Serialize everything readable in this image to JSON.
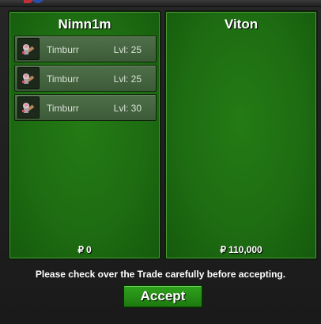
{
  "left_panel": {
    "player_name": "Nimn1m",
    "pokemon": [
      {
        "name": "Timburr",
        "level": "Lvl: 25",
        "icon": "timburr-icon"
      },
      {
        "name": "Timburr",
        "level": "Lvl: 25",
        "icon": "timburr-icon"
      },
      {
        "name": "Timburr",
        "level": "Lvl: 30",
        "icon": "timburr-icon"
      }
    ],
    "money_symbol": "₽",
    "money": "0"
  },
  "right_panel": {
    "player_name": "Viton",
    "money_symbol": "₽",
    "money": "110,000"
  },
  "notice": "Please check over the Trade carefully before accepting.",
  "accept_label": "Accept",
  "colors": {
    "panel_green": "#1e6d12",
    "button_green": "#2fa21c",
    "background": "#1f1f1f"
  }
}
